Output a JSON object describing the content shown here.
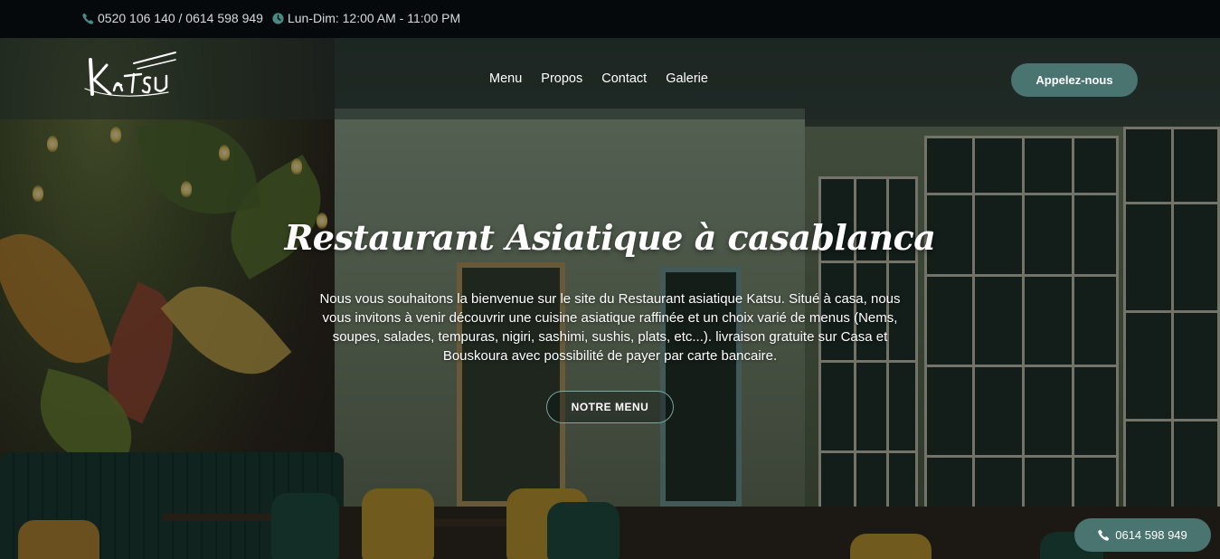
{
  "topbar": {
    "phone_icon": "phone-icon",
    "phones": "0520 106 140 / 0614 598 949",
    "clock_icon": "clock-icon",
    "hours": "Lun-Dim: 12:00 AM - 11:00 PM"
  },
  "header": {
    "logo_icon": "katsu-logo",
    "logo_text": "Katsu",
    "nav": [
      {
        "label": "Menu"
      },
      {
        "label": "Propos"
      },
      {
        "label": "Contact"
      },
      {
        "label": "Galerie"
      }
    ],
    "call_label": "Appelez-nous"
  },
  "hero": {
    "title": "Restaurant Asiatique à casablanca",
    "text": "Nous vous souhaitons la bienvenue sur le site du Restaurant asiatique Katsu. Situé à casa, nous vous invitons à venir découvrir une cuisine asiatique raffinée et un choix varié de menus (Nems, soupes, salades, tempuras, nigiri, sashimi, sushis, plats, etc...). livraison gratuite sur Casa et Bouskoura avec possibilité de payer par carte bancaire.",
    "button_label": "NOTRE MENU"
  },
  "float_phone": {
    "icon": "phone-icon",
    "label": "0614 598 949"
  },
  "colors": {
    "accent": "#4a7470",
    "topbar_bg": "#05090b"
  }
}
